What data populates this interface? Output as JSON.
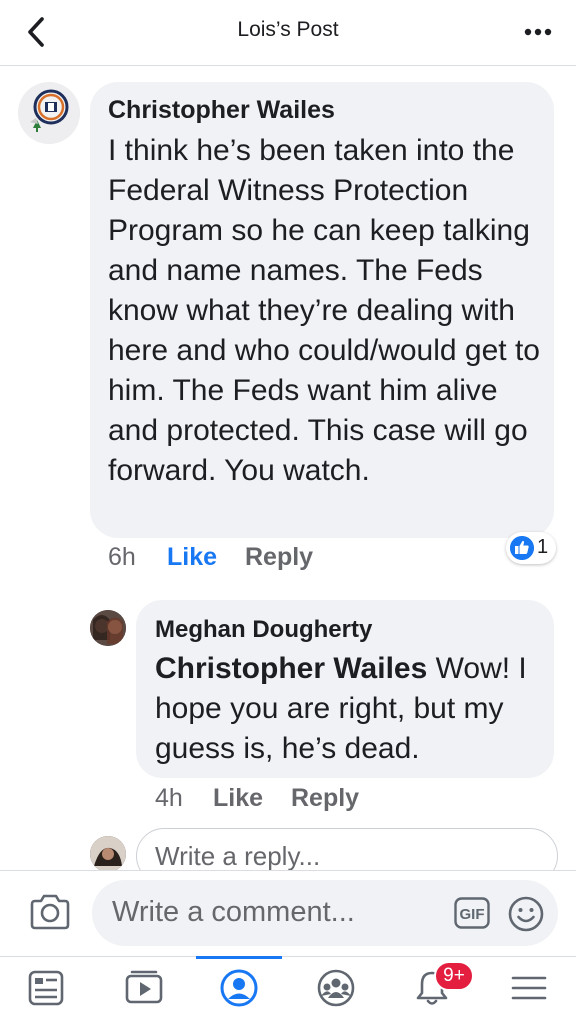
{
  "header": {
    "title": "Lois’s Post"
  },
  "comment": {
    "author": "Christopher Wailes",
    "text": "I think he’s been taken into the Federal Witness Protection Program so he can keep talking and name names. The Feds know what they’re dealing with here and who could/would get to him. The Feds want him alive and protected. This case will go forward. You watch.",
    "time": "6h",
    "like_label": "Like",
    "reply_label": "Reply",
    "reaction_count": "1",
    "reaction_icon": "like-icon"
  },
  "reply": {
    "author": "Meghan Dougherty",
    "mention": "Christopher Wailes",
    "text": " Wow! I hope you are right, but my guess is, he’s dead.",
    "time": "4h",
    "like_label": "Like",
    "reply_label": "Reply"
  },
  "reply_box": {
    "placeholder": "Write a reply..."
  },
  "composer": {
    "placeholder": "Write a comment...",
    "gif_label": "GIF"
  },
  "bottom_nav": {
    "items": [
      "news-feed-icon",
      "watch-icon",
      "profile-icon",
      "groups-icon",
      "notifications-icon",
      "menu-icon"
    ],
    "notification_badge": "9+",
    "active_color": "#1877f2"
  },
  "colors": {
    "accent": "#1877f2",
    "bubble": "#f0f2f5",
    "secondary_text": "#65676b",
    "badge": "#e41e3f"
  }
}
